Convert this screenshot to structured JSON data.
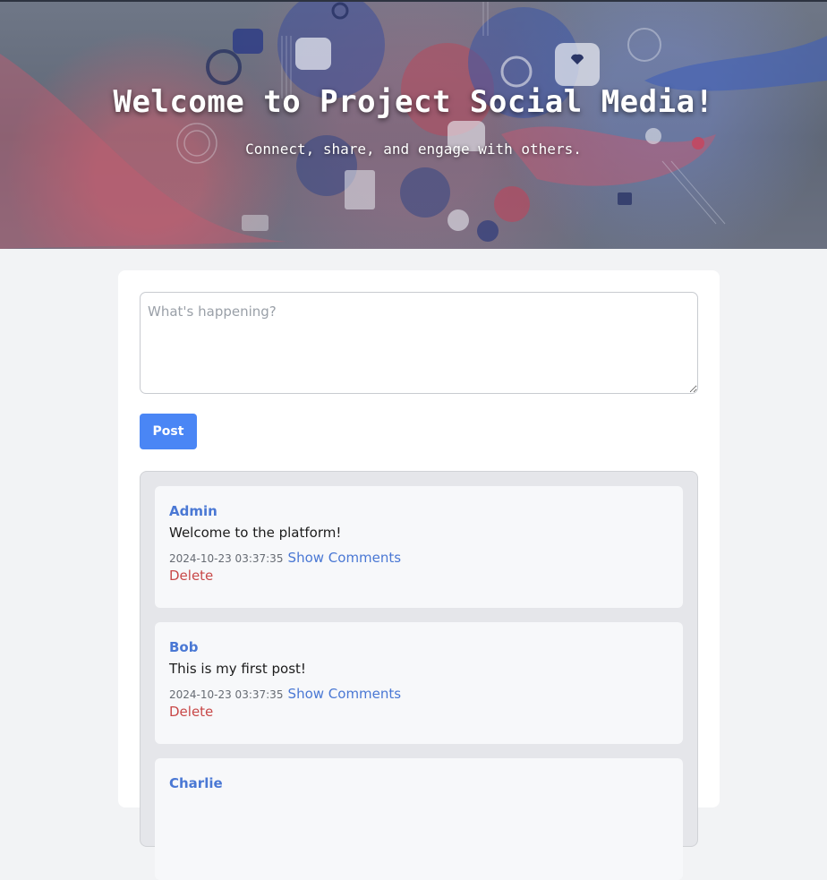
{
  "hero": {
    "title": "Welcome to Project Social Media!",
    "subtitle": "Connect, share, and engage with others."
  },
  "composer": {
    "placeholder": "What's happening?",
    "value": ""
  },
  "post_button_label": "Post",
  "posts": [
    {
      "author": "Admin",
      "content": "Welcome to the platform!",
      "timestamp": "2024-10-23 03:37:35",
      "show_comments_label": "Show Comments",
      "delete_label": "Delete"
    },
    {
      "author": "Bob",
      "content": "This is my first post!",
      "timestamp": "2024-10-23 03:37:35",
      "show_comments_label": "Show Comments",
      "delete_label": "Delete"
    },
    {
      "author": "Charlie",
      "content": "",
      "timestamp": "",
      "show_comments_label": "",
      "delete_label": ""
    }
  ],
  "colors": {
    "accent": "#4a86f5",
    "author_link": "#4a78d4",
    "delete": "#c84848",
    "page_background": "#f2f3f5"
  }
}
